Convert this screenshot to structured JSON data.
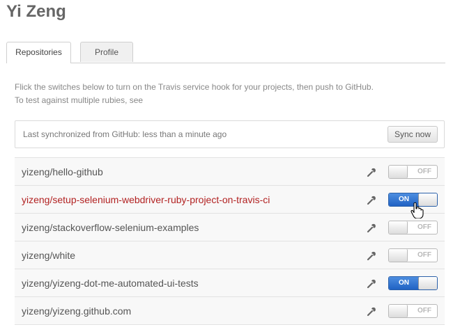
{
  "page": {
    "title": "Yi Zeng"
  },
  "tabs": [
    {
      "label": "Repositories",
      "active": true
    },
    {
      "label": "Profile",
      "active": false
    }
  ],
  "intro": {
    "line1": "Flick the switches below to turn on the Travis service hook for your projects, then push to GitHub.",
    "line2": "To test against multiple rubies, see"
  },
  "sync": {
    "status_text": "Last synchronized from GitHub: less than a minute ago",
    "button_label": "Sync now"
  },
  "repos": [
    {
      "name": "yizeng/hello-github",
      "state": "OFF",
      "on": false,
      "highlight": false
    },
    {
      "name": "yizeng/setup-selenium-webdriver-ruby-project-on-travis-ci",
      "state": "ON",
      "on": true,
      "highlight": true
    },
    {
      "name": "yizeng/stackoverflow-selenium-examples",
      "state": "OFF",
      "on": false,
      "highlight": false
    },
    {
      "name": "yizeng/white",
      "state": "OFF",
      "on": false,
      "highlight": false
    },
    {
      "name": "yizeng/yizeng-dot-me-automated-ui-tests",
      "state": "ON",
      "on": true,
      "highlight": false
    },
    {
      "name": "yizeng/yizeng.github.com",
      "state": "OFF",
      "on": false,
      "highlight": false
    }
  ],
  "icons": {
    "settings": "wrench-icon",
    "pointer": "hand-cursor-icon"
  },
  "colors": {
    "accent_on": "#2062c4",
    "active_repo": "#b22222"
  }
}
